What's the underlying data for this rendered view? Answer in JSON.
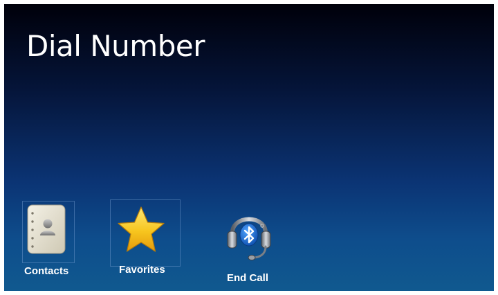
{
  "screen": {
    "title": "Dial Number"
  },
  "apps": [
    {
      "label": "Contacts",
      "icon": "contacts-book-icon"
    },
    {
      "label": "Favorites",
      "icon": "star-icon"
    },
    {
      "label": "End Call",
      "icon": "bluetooth-headset-icon"
    }
  ],
  "colors": {
    "background_top": "#00000a",
    "background_bottom": "#10598f",
    "text": "#ffffff",
    "star": "#f7c51e",
    "bluetooth": "#1c6fd1"
  }
}
